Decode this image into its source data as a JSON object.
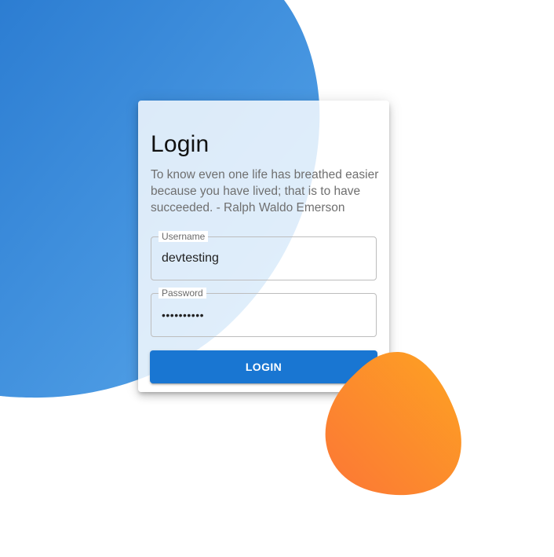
{
  "login": {
    "title": "Login",
    "quote": "To know even one life has breathed easier because you have lived; that is to have succeeded. - Ralph Waldo Emerson",
    "username_label": "Username",
    "username_value": "devtesting",
    "password_label": "Password",
    "password_value": "password12",
    "button_label": "LOGIN"
  },
  "colors": {
    "primary": "#1976d2",
    "blob_blue_start": "#2f80d4",
    "blob_blue_end": "#57a6ea",
    "blob_orange_start": "#fda124",
    "blob_orange_end": "#fc7a35"
  }
}
